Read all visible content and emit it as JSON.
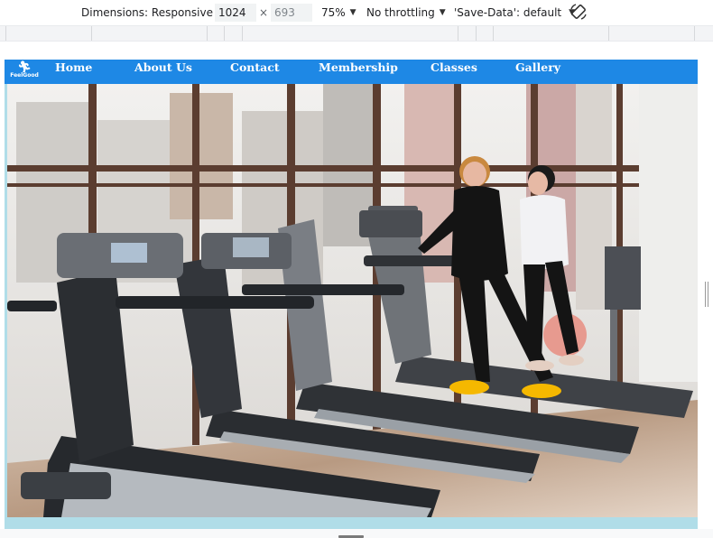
{
  "devtools": {
    "dimensions_label": "Dimensions: Responsive",
    "width_value": "1024",
    "times": "×",
    "height_placeholder": "693",
    "zoom": "75%",
    "throttling": "No throttling",
    "save_data": "'Save-Data': default"
  },
  "site": {
    "logo_text": "FeelGood",
    "nav": [
      "Home",
      "About Us",
      "Contact",
      "Membership",
      "Classes",
      "Gallery"
    ]
  },
  "colors": {
    "nav_bg": "#1e88e5",
    "page_bg": "#b0dde8",
    "sneaker": "#f5b800"
  }
}
